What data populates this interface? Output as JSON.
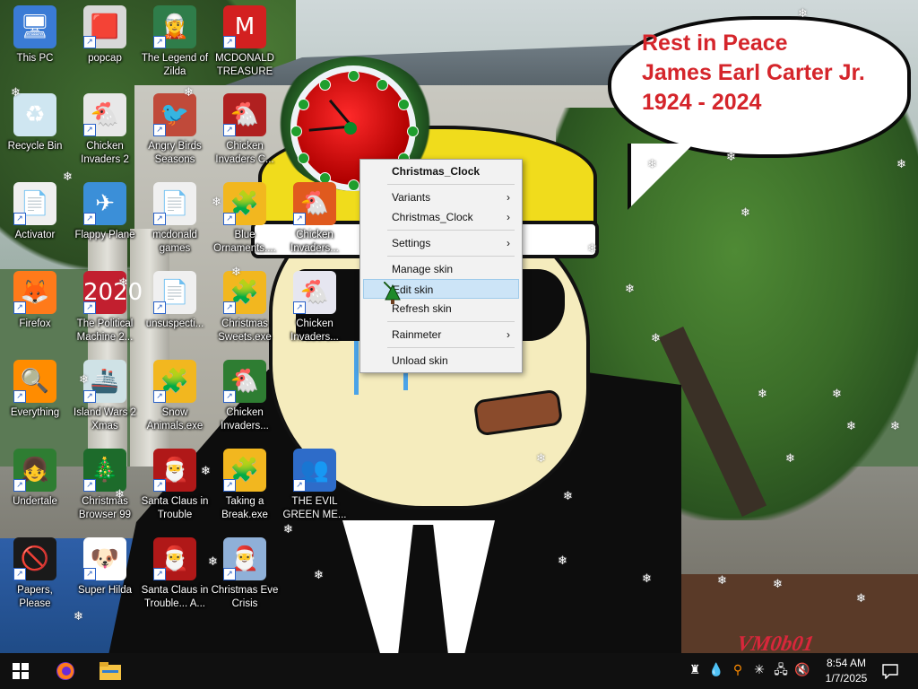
{
  "desktop": {
    "icons": [
      {
        "label": "This PC",
        "glyph": "🖥",
        "bg": "#3a7bd5"
      },
      {
        "label": "popcap",
        "glyph": "🟥",
        "bg": "#d8d8d8"
      },
      {
        "label": "The Legend of Zilda",
        "glyph": "🧝",
        "bg": "#2f7d4a"
      },
      {
        "label": "MCDONALD TREASURE",
        "glyph": "M",
        "bg": "#d32020"
      },
      {
        "label": "Recycle Bin",
        "glyph": "♻",
        "bg": "#cfe6f1"
      },
      {
        "label": "Chicken Invaders 2",
        "glyph": "🐔",
        "bg": "#e8e8e8"
      },
      {
        "label": "Angry Birds Seasons",
        "glyph": "🐦",
        "bg": "#c04a3a"
      },
      {
        "label": "Chicken Invaders C...",
        "glyph": "🐔",
        "bg": "#b02020"
      },
      {
        "label": "Activator",
        "glyph": "📄",
        "bg": "#f0f0f0"
      },
      {
        "label": "Flappy Plane",
        "glyph": "✈",
        "bg": "#3b8fd8"
      },
      {
        "label": "mcdonald games",
        "glyph": "📄",
        "bg": "#f0f0f0"
      },
      {
        "label": "Blue Ornaments....",
        "glyph": "🧩",
        "bg": "#f2b71f"
      },
      {
        "label": "Chicken Invaders...",
        "glyph": "🐔",
        "bg": "#e05a1e"
      },
      {
        "label": "Firefox",
        "glyph": "🦊",
        "bg": "#ff7a1a"
      },
      {
        "label": "The Political Machine 2...",
        "glyph": "2020",
        "bg": "#c21f2f"
      },
      {
        "label": "unsuspecti...",
        "glyph": "📄",
        "bg": "#f0f0f0"
      },
      {
        "label": "Christmas Sweets.exe",
        "glyph": "🧩",
        "bg": "#f2b71f"
      },
      {
        "label": "Chicken Invaders...",
        "glyph": "🐔",
        "bg": "#e6e6f0"
      },
      {
        "label": "Everything",
        "glyph": "🔍",
        "bg": "#ff8c00"
      },
      {
        "label": "Island Wars 2 Xmas",
        "glyph": "🚢",
        "bg": "#cfe2e6"
      },
      {
        "label": "Snow Animals.exe",
        "glyph": "🧩",
        "bg": "#f2b71f"
      },
      {
        "label": "Chicken Invaders...",
        "glyph": "🐔",
        "bg": "#2e7d32"
      },
      {
        "label": "Undertale",
        "glyph": "👧",
        "bg": "#2e7d32"
      },
      {
        "label": "Christmas Browser 99",
        "glyph": "🎄",
        "bg": "#1d6b2b"
      },
      {
        "label": "Santa Claus in Trouble",
        "glyph": "🎅",
        "bg": "#b01818"
      },
      {
        "label": "Taking a Break.exe",
        "glyph": "🧩",
        "bg": "#f2b71f"
      },
      {
        "label": "THE EVIL GREEN ME...",
        "glyph": "👥",
        "bg": "#2e6cc9"
      },
      {
        "label": "Papers, Please",
        "glyph": "🚫",
        "bg": "#1a1a1a"
      },
      {
        "label": "Super Hilda",
        "glyph": "🐶",
        "bg": "#ffffff"
      },
      {
        "label": "Santa Claus in Trouble... A...",
        "glyph": "🎅",
        "bg": "#b01818"
      },
      {
        "label": "Christmas Eve Crisis",
        "glyph": "🎅",
        "bg": "#8fb0d8"
      }
    ]
  },
  "bubble": {
    "line1": "Rest in Peace",
    "line2": "James Earl Carter Jr.",
    "line3": "1924 - 2024",
    "color": "#d5252b"
  },
  "context_menu": {
    "header": "Christmas_Clock",
    "items": [
      {
        "label": "Variants",
        "submenu": true
      },
      {
        "label": "Christmas_Clock",
        "submenu": true
      },
      {
        "label": "Settings",
        "submenu": true
      },
      {
        "label": "Manage skin",
        "submenu": false
      },
      {
        "label": "Edit skin",
        "submenu": false,
        "hover": true
      },
      {
        "label": "Refresh skin",
        "submenu": false
      },
      {
        "label": "Rainmeter",
        "submenu": true
      },
      {
        "label": "Unload skin",
        "submenu": false
      }
    ]
  },
  "taskbar": {
    "start_icon": "windows-start-icon",
    "pinned": [
      "firefox-icon",
      "file-explorer-icon"
    ],
    "tray_icons": [
      "app-icon",
      "water-drop-icon",
      "everything-icon",
      "snowflake-icon",
      "network-icon",
      "volume-muted-icon"
    ],
    "time": "8:54 AM",
    "date": "1/7/2025",
    "notification_icon": "notification-icon"
  },
  "watermark": "VM0b01"
}
